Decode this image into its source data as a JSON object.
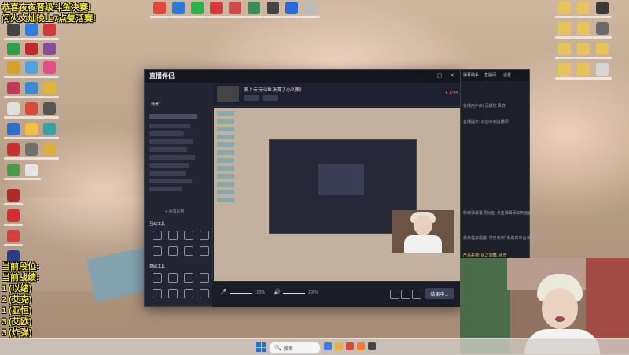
{
  "overlay": {
    "title_line1": "恭喜夜夜晋级斗鱼决赛!",
    "title_line2": "闪火文灿晚上7点复活赛!",
    "rank_label": "当前段位:",
    "record_label": "当前战绩:",
    "record": [
      "1 (以绪)",
      "2 (艾克)",
      "1 (亚恒)",
      "3 (艾欧)",
      "3 (炸弹)"
    ]
  },
  "app": {
    "name": "直播伴侣",
    "window_controls": "— ▢ ✕",
    "top": {
      "stream_title": "鹅上云玩斗鱼决赛了小利鹅!",
      "stats": "● 1794"
    },
    "left": {
      "section_scene": "场景1",
      "section_tools": "互动工具",
      "section_basic": "基础工具",
      "add_scene": "+ 添加素材"
    },
    "bottom": {
      "mic_pct": "100%",
      "spk_pct": "100%",
      "go_live": "结束中..."
    }
  },
  "side": {
    "tabs": [
      "弹幕助手",
      "直播间",
      "设置"
    ],
    "row1": "在线用户(0)  贡献榜  贵宾",
    "row2": "直播提示: 欢迎来到直播间",
    "row3": "新增弹幕置顶功能, 点击弹幕添加到画面",
    "row4": "最高任务提醒: 您已收到1条最高平台派发的任务",
    "row5": "产品名称: 风之剑舞, 点击"
  },
  "taskbar": {
    "search_placeholder": "搜索",
    "search_icon": "🔍"
  },
  "colors": {
    "overlay_text": "#f4e63a",
    "app_bg": "#1d1f29",
    "accent_red": "#ff6b6b",
    "start_blue": "#1a6fd6"
  }
}
